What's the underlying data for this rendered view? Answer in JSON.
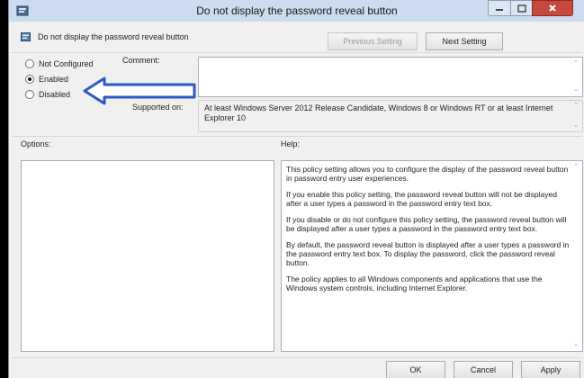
{
  "window": {
    "title": "Do not display the password reveal button"
  },
  "header": {
    "policy_title": "Do not display the password reveal button"
  },
  "nav": {
    "previous_label": "Previous Setting",
    "next_label": "Next Setting"
  },
  "state": {
    "options": [
      {
        "label": "Not Configured",
        "selected": false
      },
      {
        "label": "Enabled",
        "selected": true
      },
      {
        "label": "Disabled",
        "selected": false
      }
    ]
  },
  "comment": {
    "label": "Comment:",
    "value": ""
  },
  "supported": {
    "label": "Supported on:",
    "value": "At least Windows Server 2012 Release Candidate, Windows 8 or Windows RT or at least Internet Explorer 10"
  },
  "options_pane": {
    "label": "Options:"
  },
  "help": {
    "label": "Help:",
    "paragraphs": [
      "This policy setting allows you to configure the display of the password reveal button in password entry user experiences.",
      "If you enable this policy setting, the password reveal button will not be displayed after a user types a password in the password entry text box.",
      "If you disable or do not configure this policy setting, the password reveal button will be displayed after a user types a password in the password entry text box.",
      "By default, the password reveal button is displayed after a user types a password in the password entry text box. To display the password, click the password reveal button.",
      "The policy applies to all Windows components and applications that use the Windows system controls, including Internet Explorer."
    ]
  },
  "footer": {
    "ok_label": "OK",
    "cancel_label": "Cancel",
    "apply_label": "Apply"
  },
  "colors": {
    "annotation_arrow": "#2e57c6",
    "close_button": "#c74a3f"
  }
}
